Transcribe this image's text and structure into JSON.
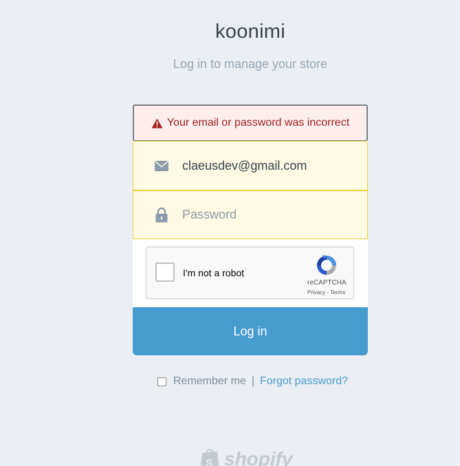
{
  "header": {
    "store_name": "koonimi",
    "subtitle": "Log in to manage your store"
  },
  "error": {
    "message": "Your email or password was incorrect",
    "icon": "warning-icon",
    "color": "#a0221e"
  },
  "form": {
    "email_value": "claeusdev@gmail.com",
    "email_icon": "envelope-icon",
    "password_placeholder": "Password",
    "password_icon": "lock-icon",
    "field_highlight_color": "#fefae3"
  },
  "captcha": {
    "label": "I'm not a robot",
    "brand": "reCAPTCHA",
    "links": "Privacy - Terms"
  },
  "login_button": {
    "label": "Log in",
    "color": "#479ccf"
  },
  "footer": {
    "remember_label": "Remember me",
    "separator": "|",
    "forgot_label": "Forgot password?",
    "logo_text": "shopify"
  }
}
